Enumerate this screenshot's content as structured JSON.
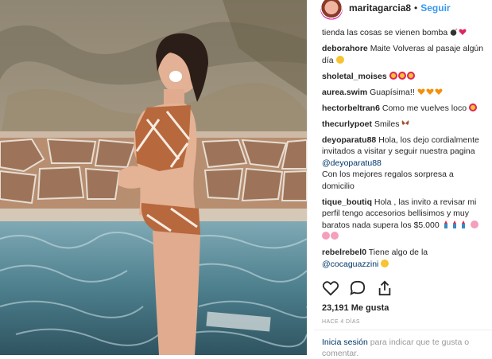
{
  "header": {
    "username": "maritagarcia8",
    "separator": "•",
    "follow_label": "Seguir"
  },
  "comments": [
    {
      "user": "",
      "text": "tienda las cosas se vienen bomba",
      "emoji": [
        "bomb",
        "red-heart"
      ]
    },
    {
      "user": "deborahore",
      "text": "Maite Volveras al pasaje algún día",
      "emoji": [
        "grinning-sweat"
      ]
    },
    {
      "user": "sholetal_moises",
      "text": "",
      "emoji": [
        "heart-eyes",
        "heart-eyes",
        "heart-eyes"
      ]
    },
    {
      "user": "aurea.swim",
      "text": "Guapísima!!",
      "emoji": [
        "orange-heart",
        "orange-heart",
        "orange-heart"
      ]
    },
    {
      "user": "hectorbeltran6",
      "text": "Como me vuelves loco",
      "emoji": [
        "heart-eyes"
      ]
    },
    {
      "user": "thecurlypoet",
      "text": "Smiles",
      "emoji": [
        "butterfly"
      ]
    },
    {
      "user": "deyoparatu88",
      "text": "Hola, los dejo cordialmente invitados a visitar y seguir nuestra pagina",
      "mention": "@deyoparatu88",
      "text2": "Con los mejores regalos sorpresa a domicilio",
      "emoji": []
    },
    {
      "user": "tique_boutiq",
      "text": "Hola , las invito a revisar mi perfil tengo accesorios bellisimos y muy baratos nada supera los $5.000",
      "emoji": [
        "lipstick",
        "lipstick",
        "lipstick",
        "flower",
        "flower",
        "flower"
      ]
    },
    {
      "user": "rebelrebel0",
      "text": "Tiene algo de la",
      "mention": "@cocaguazzini",
      "emoji": [
        "grinning-sweat"
      ]
    }
  ],
  "actions": {
    "like_icon": "heart-outline-icon",
    "comment_icon": "comment-icon",
    "share_icon": "share-icon"
  },
  "likes": "23,191 Me gusta",
  "time": "HACE 4 DÍAS",
  "login": {
    "link": "Inicia sesión",
    "text": "para indicar que te gusta o comentar."
  },
  "colors": {
    "link_blue": "#3897f0",
    "mention_blue": "#003569",
    "muted": "#999999",
    "text": "#262626"
  }
}
